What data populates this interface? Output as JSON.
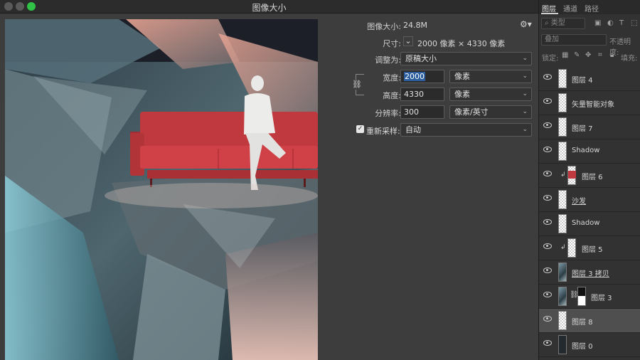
{
  "dialog": {
    "title": "图像大小",
    "image_size_label": "图像大小:",
    "image_size_value": "24.8M",
    "dimensions_label": "尺寸:",
    "dimensions_value": "2000 像素  ×  4330 像素",
    "fit_to_label": "调整为:",
    "fit_to_value": "原稿大小",
    "width_label": "宽度:",
    "width_value": "2000",
    "width_unit": "像素",
    "height_label": "高度:",
    "height_value": "4330",
    "height_unit": "像素",
    "resolution_label": "分辨率:",
    "resolution_value": "300",
    "resolution_unit": "像素/英寸",
    "resample_label": "重新采样:",
    "resample_value": "自动",
    "resample_checked": true
  },
  "panel": {
    "tabs": [
      "图层",
      "通道",
      "路径"
    ],
    "kind_filter": "类型",
    "blend_mode": "叠加",
    "opacity_label": "不透明度:",
    "lock_label": "锁定:",
    "fill_label": "填充:",
    "layers": [
      {
        "name": "图层 4",
        "thumb": "transparent",
        "clipped": false,
        "underline": false
      },
      {
        "name": "矢量智能对象",
        "thumb": "transparent",
        "clipped": false,
        "underline": false
      },
      {
        "name": "图层 7",
        "thumb": "transparent",
        "clipped": false,
        "underline": false
      },
      {
        "name": "Shadow",
        "thumb": "transparent",
        "clipped": false,
        "underline": false
      },
      {
        "name": "图层 6",
        "thumb": "transparent-red",
        "clipped": true,
        "underline": false
      },
      {
        "name": "沙发",
        "thumb": "transparent",
        "clipped": false,
        "underline": true
      },
      {
        "name": "Shadow",
        "thumb": "transparent",
        "clipped": false,
        "underline": false
      },
      {
        "name": "图层 5",
        "thumb": "transparent",
        "clipped": true,
        "underline": false
      },
      {
        "name": "图层 3 拷贝",
        "thumb": "image",
        "clipped": false,
        "underline": true
      },
      {
        "name": "图层 3",
        "thumb": "image-mask",
        "clipped": false,
        "underline": false
      },
      {
        "name": "图层 8",
        "thumb": "transparent",
        "clipped": false,
        "underline": false,
        "selected": true
      },
      {
        "name": "图层 0",
        "thumb": "dark",
        "clipped": false,
        "underline": false
      }
    ]
  },
  "colors": {
    "accent_selection": "#2d5f9f",
    "sofa": "#c0393e",
    "maximize": "#2fc245"
  }
}
